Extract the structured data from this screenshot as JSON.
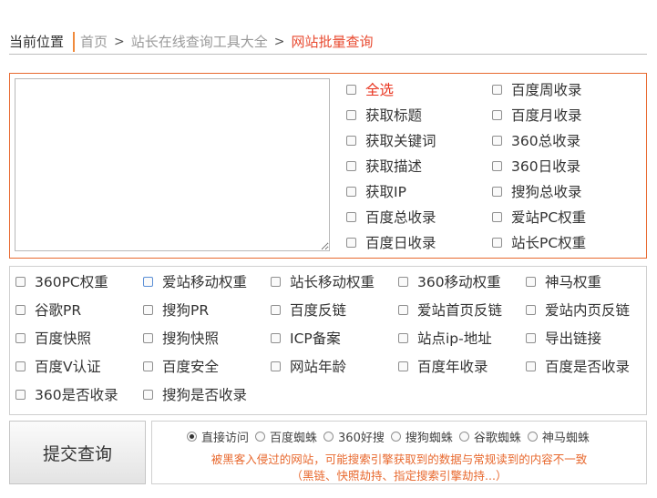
{
  "breadcrumb": {
    "current_label": "当前位置",
    "home": "首页",
    "sep": ">",
    "tools": "站长在线查询工具大全",
    "active": "网站批量查询"
  },
  "panel": {
    "url_value": "",
    "options_left": [
      "全选",
      "获取标题",
      "获取关键词",
      "获取描述",
      "获取IP",
      "百度总收录",
      "百度日收录"
    ],
    "options_right": [
      "百度周收录",
      "百度月收录",
      "360总收录",
      "360日收录",
      "搜狗总收录",
      "爱站PC权重",
      "站长PC权重"
    ]
  },
  "grid": {
    "rows": [
      [
        "360PC权重",
        "爱站移动权重",
        "站长移动权重",
        "360移动权重",
        "神马权重"
      ],
      [
        "谷歌PR",
        "搜狗PR",
        "百度反链",
        "爱站首页反链",
        "爱站内页反链"
      ],
      [
        "百度快照",
        "搜狗快照",
        "ICP备案",
        "站点ip-地址",
        "导出链接"
      ],
      [
        "百度V认证",
        "百度安全",
        "网站年龄",
        "百度年收录",
        "百度是否收录"
      ],
      [
        "360是否收录",
        "搜狗是否收录"
      ]
    ]
  },
  "submit_label": "提交查询",
  "engines": [
    "直接访问",
    "百度蜘蛛",
    "360好搜",
    "搜狗蜘蛛",
    "谷歌蜘蛛",
    "神马蜘蛛"
  ],
  "selected_engine": "直接访问",
  "warning": {
    "line1": "被黑客入侵过的网站，可能搜索引擎获取到的数据与常规读到的内容不一致",
    "line2": "（黑链、快照劫持、指定搜索引擎劫持...）"
  },
  "colors": {
    "accent": "#e8692f",
    "active_red": "#e8321d"
  }
}
